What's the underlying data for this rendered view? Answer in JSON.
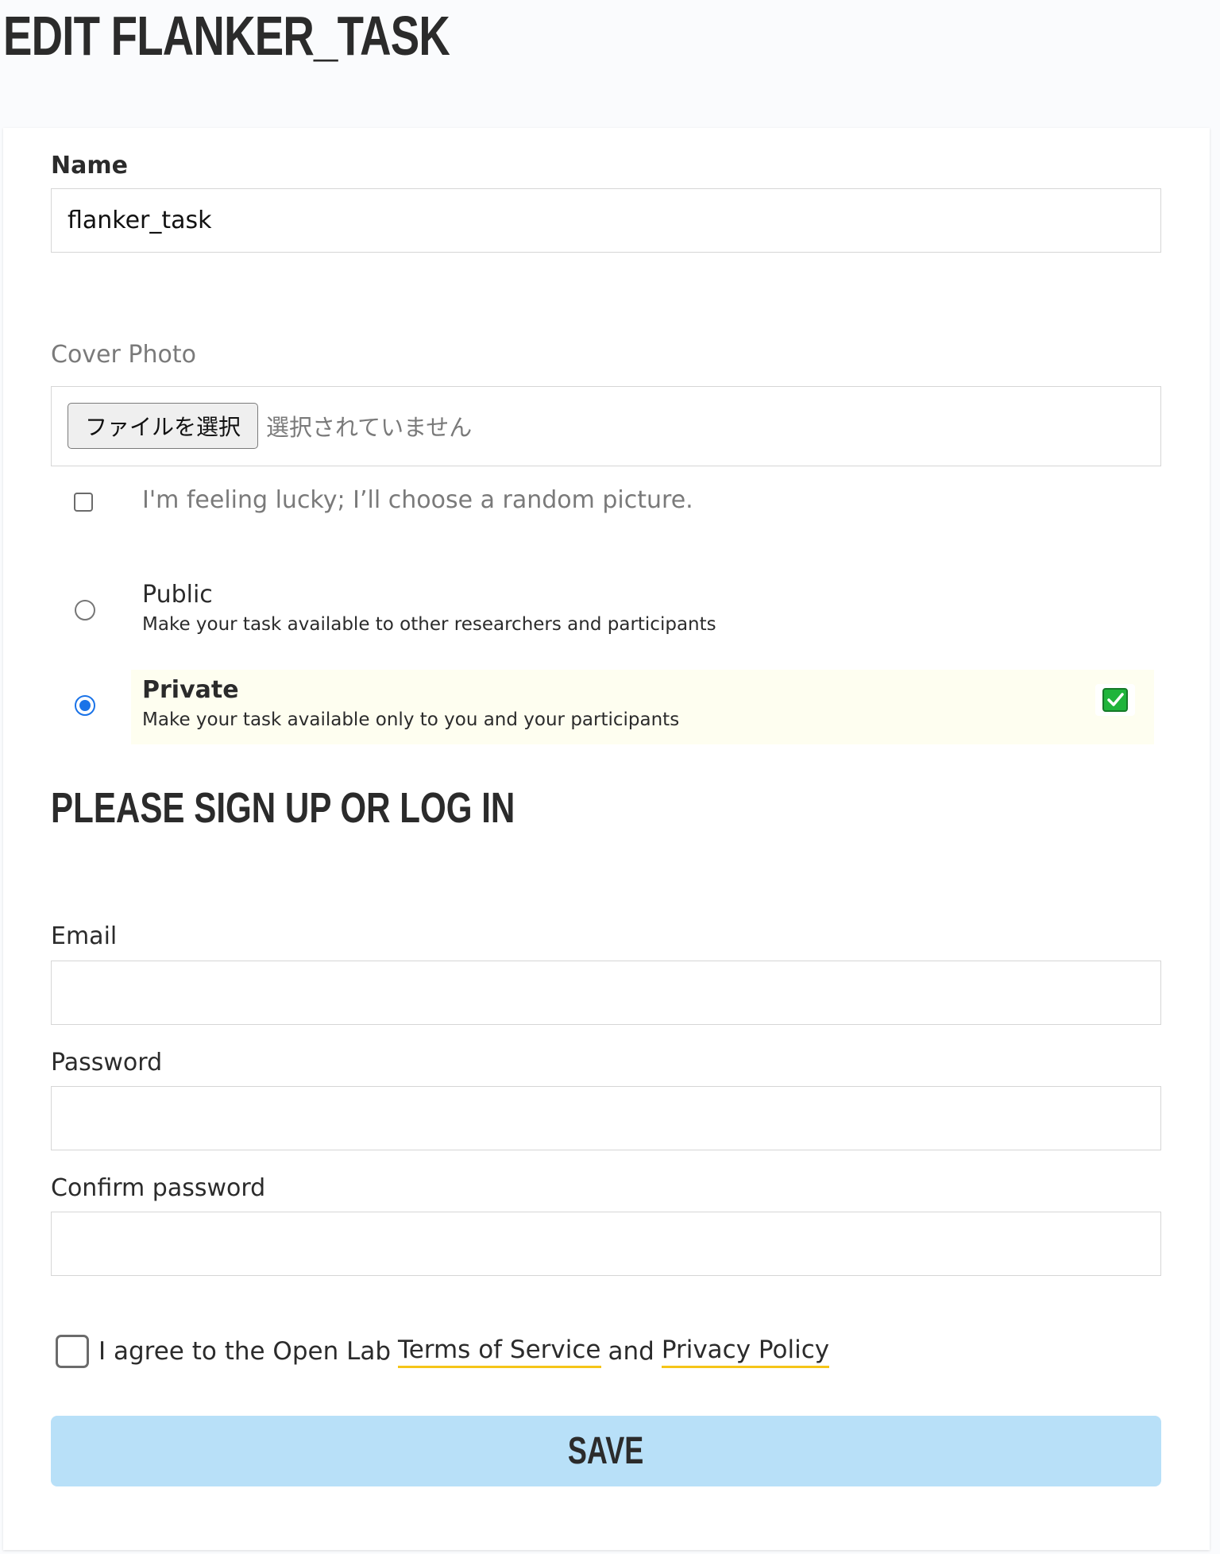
{
  "page": {
    "title": "EDIT FLANKER_TASK"
  },
  "form": {
    "name_label": "Name",
    "name_value": "flanker_task",
    "cover_photo_label": "Cover Photo",
    "file_button_label": "ファイルを選択",
    "file_status": "選択されていません",
    "random_picture_label": "I'm feeling lucky; I’ll choose a random picture.",
    "visibility": {
      "selected": "Private",
      "public": {
        "title": "Public",
        "description": "Make your task available to other researchers and participants"
      },
      "private": {
        "title": "Private",
        "description": "Make your task available only to you and your participants"
      }
    },
    "selected_check_icon": "check-mark-icon",
    "selected_check_color": "#1fb43b"
  },
  "signup": {
    "heading": "PLEASE SIGN UP OR LOG IN",
    "email_label": "Email",
    "email_value": "",
    "password_label": "Password",
    "password_value": "",
    "confirm_password_label": "Confirm password",
    "confirm_password_value": "",
    "agree_prefix": "I agree to the Open Lab",
    "terms_link": "Terms of Service",
    "agree_and": "and",
    "privacy_link": "Privacy Policy",
    "link_underline_color": "#f5c518"
  },
  "actions": {
    "save_label": "SAVE",
    "save_color": "#b8e0f8"
  },
  "colors": {
    "radio_accent": "#1a73e8",
    "private_highlight": "#fefef0"
  }
}
